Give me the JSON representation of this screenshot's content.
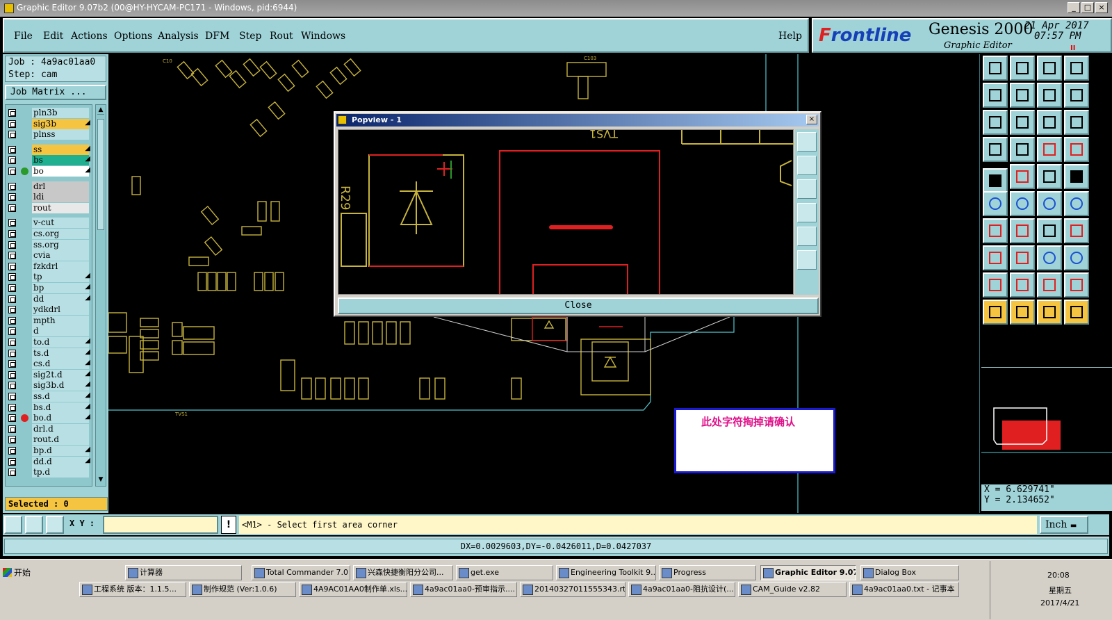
{
  "window": {
    "title": "Graphic Editor 9.07b2 (00@HY-HYCAM-PC171 - Windows, pid:6944)",
    "controls": [
      "_",
      "□",
      "×"
    ]
  },
  "menu": {
    "items": [
      "File",
      "Edit",
      "Actions",
      "Options",
      "Analysis",
      "DFM",
      "Step",
      "Rout",
      "Windows"
    ],
    "help": "Help"
  },
  "brand": {
    "logo_prefix": "F",
    "logo_rest": "rontline",
    "product": "Genesis 2000",
    "subtitle": "Graphic Editor",
    "date": "21 Apr 2017",
    "time": "07:57 PM",
    "pause_icon": "II"
  },
  "job": {
    "job_label": "Job  : 4a9ac01aa0",
    "step_label": "Step: cam",
    "matrix_label": "Job Matrix ..."
  },
  "layers": [
    {
      "name": "pln3b",
      "color": "#b8e0e4",
      "arrow": false
    },
    {
      "name": "sig3b",
      "color": "#f5c542",
      "arrow": true
    },
    {
      "name": "plnss",
      "color": "#b8e0e4",
      "arrow": false
    },
    {
      "name": "ss",
      "color": "#f5c542",
      "arrow": true
    },
    {
      "name": "bs",
      "color": "#20b090",
      "arrow": true
    },
    {
      "name": "bo",
      "color": "#ffffff",
      "arrow": true,
      "dot": "#2a9a2a"
    },
    {
      "name": "drl",
      "color": "#c8c8c8",
      "arrow": false
    },
    {
      "name": "ldi",
      "color": "#c8c8c8",
      "arrow": false
    },
    {
      "name": "rout",
      "color": "#e8e8e8",
      "arrow": false
    },
    {
      "name": "v-cut",
      "color": "#b8e0e4",
      "arrow": false
    },
    {
      "name": "cs.org",
      "color": "#b8e0e4",
      "arrow": false
    },
    {
      "name": "ss.org",
      "color": "#b8e0e4",
      "arrow": false
    },
    {
      "name": "cvia",
      "color": "#b8e0e4",
      "arrow": false
    },
    {
      "name": "fzkdrl",
      "color": "#b8e0e4",
      "arrow": false
    },
    {
      "name": "tp",
      "color": "#b8e0e4",
      "arrow": true
    },
    {
      "name": "bp",
      "color": "#b8e0e4",
      "arrow": true
    },
    {
      "name": "dd",
      "color": "#b8e0e4",
      "arrow": true
    },
    {
      "name": "ydkdrl",
      "color": "#b8e0e4",
      "arrow": false
    },
    {
      "name": "mpth",
      "color": "#b8e0e4",
      "arrow": false
    },
    {
      "name": "d",
      "color": "#b8e0e4",
      "arrow": false
    },
    {
      "name": "to.d",
      "color": "#b8e0e4",
      "arrow": true
    },
    {
      "name": "ts.d",
      "color": "#b8e0e4",
      "arrow": true
    },
    {
      "name": "cs.d",
      "color": "#b8e0e4",
      "arrow": true
    },
    {
      "name": "sig2t.d",
      "color": "#b8e0e4",
      "arrow": true
    },
    {
      "name": "sig3b.d",
      "color": "#b8e0e4",
      "arrow": true
    },
    {
      "name": "ss.d",
      "color": "#b8e0e4",
      "arrow": true
    },
    {
      "name": "bs.d",
      "color": "#b8e0e4",
      "arrow": true
    },
    {
      "name": "bo.d",
      "color": "#b8e0e4",
      "arrow": true,
      "dot": "#e02020"
    },
    {
      "name": "drl.d",
      "color": "#b8e0e4",
      "arrow": false
    },
    {
      "name": "rout.d",
      "color": "#b8e0e4",
      "arrow": false
    },
    {
      "name": "bp.d",
      "color": "#b8e0e4",
      "arrow": true
    },
    {
      "name": "dd.d",
      "color": "#b8e0e4",
      "arrow": true
    },
    {
      "name": "tp.d",
      "color": "#b8e0e4",
      "arrow": false
    }
  ],
  "selected_label": "Selected : 0",
  "popview": {
    "title": "Popview - 1",
    "close_label": "Close",
    "close_x": "×"
  },
  "note_text": "此处字符掏掉请确认",
  "coords": {
    "x": "X = 6.629741\"",
    "y": "Y = 2.134652\""
  },
  "cmd": {
    "xy_label": "X Y :",
    "input_value": "",
    "msg_icon": "!",
    "message": "<M1> - Select first area corner",
    "unit": "Inch"
  },
  "status": "DX=0.0029603,DY=-0.0426011,D=0.0427037",
  "taskbar": {
    "start": "开始",
    "row1": [
      "计算器",
      "Total Commander 7.0 ...",
      "兴森快捷衡阳分公司...",
      "get.exe",
      "Engineering Toolkit 9....",
      "Progress",
      "Graphic Editor 9.07...",
      "Dialog Box"
    ],
    "row2": [
      "工程系统  版本：1.1.5...",
      "制作规范 (Ver:1.0.6)",
      "4A9AC01AA0制作单.xls...",
      "4a9ac01aa0-预审指示....",
      "20140327011555343.rtf...",
      "4a9ac01aa0-阻抗设计(...",
      "CAM_Guide v2.82",
      "4a9ac01aa0.txt - 记事本"
    ],
    "time": "20:08",
    "day": "星期五",
    "date": "2017/4/21"
  },
  "colors": {
    "panel": "#9fd3d8",
    "silkscreen": "#c8b43c",
    "highlight": "#e02020",
    "outline": "#50c8d0"
  }
}
